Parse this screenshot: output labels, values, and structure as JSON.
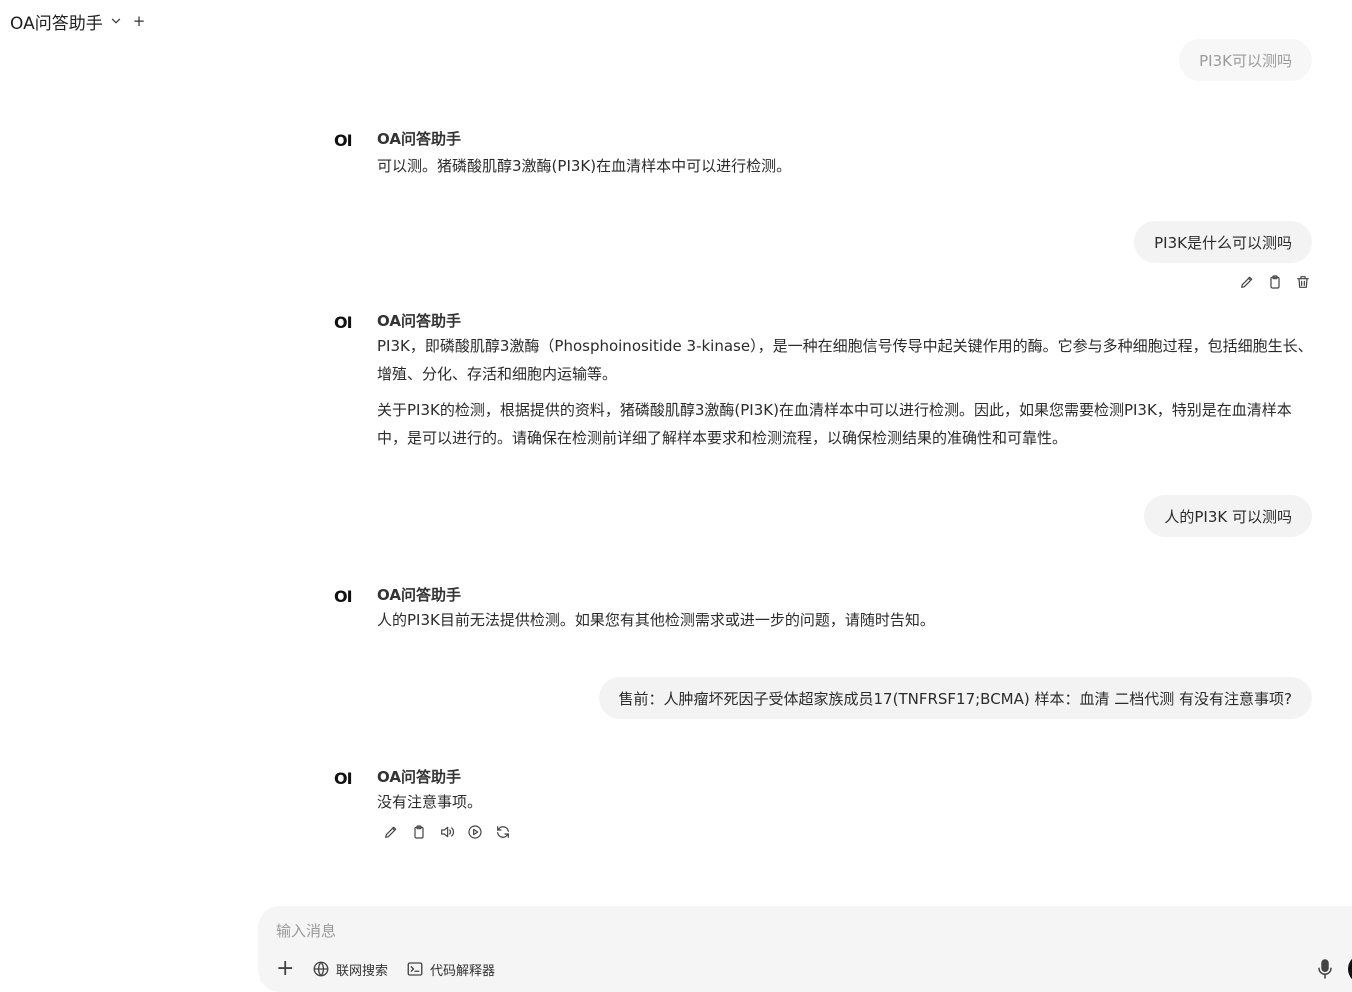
{
  "header": {
    "model_name": "OA问答助手",
    "new_chat_label": "+"
  },
  "messages": [
    {
      "role": "user",
      "text": "PI3K可以测吗"
    },
    {
      "role": "assistant",
      "name": "OA问答助手",
      "paragraphs": [
        "可以测。猪磷酸肌醇3激酶(PI3K)在血清样本中可以进行检测。"
      ]
    },
    {
      "role": "user",
      "text": "PI3K是什么可以测吗"
    },
    {
      "role": "assistant",
      "name": "OA问答助手",
      "paragraphs": [
        "PI3K，即磷酸肌醇3激酶（Phosphoinositide 3-kinase），是一种在细胞信号传导中起关键作用的酶。它参与多种细胞过程，包括细胞生长、增殖、分化、存活和细胞内运输等。",
        "关于PI3K的检测，根据提供的资料，猪磷酸肌醇3激酶(PI3K)在血清样本中可以进行检测。因此，如果您需要检测PI3K，特别是在血清样本中，是可以进行的。请确保在检测前详细了解样本要求和检测流程，以确保检测结果的准确性和可靠性。"
      ]
    },
    {
      "role": "user",
      "text": "人的PI3K 可以测吗"
    },
    {
      "role": "assistant",
      "name": "OA问答助手",
      "paragraphs": [
        "人的PI3K目前无法提供检测。如果您有其他检测需求或进一步的问题，请随时告知。"
      ]
    },
    {
      "role": "user",
      "text": "售前：人肿瘤坏死因子受体超家族成员17(TNFRSF17;BCMA) 样本：血清 二档代测 有没有注意事项?"
    },
    {
      "role": "assistant",
      "name": "OA问答助手",
      "paragraphs": [
        "没有注意事项。"
      ]
    }
  ],
  "composer": {
    "placeholder": "输入消息",
    "web_search_label": "联网搜索",
    "code_interpreter_label": "代码解释器"
  },
  "logo_text": "OI"
}
